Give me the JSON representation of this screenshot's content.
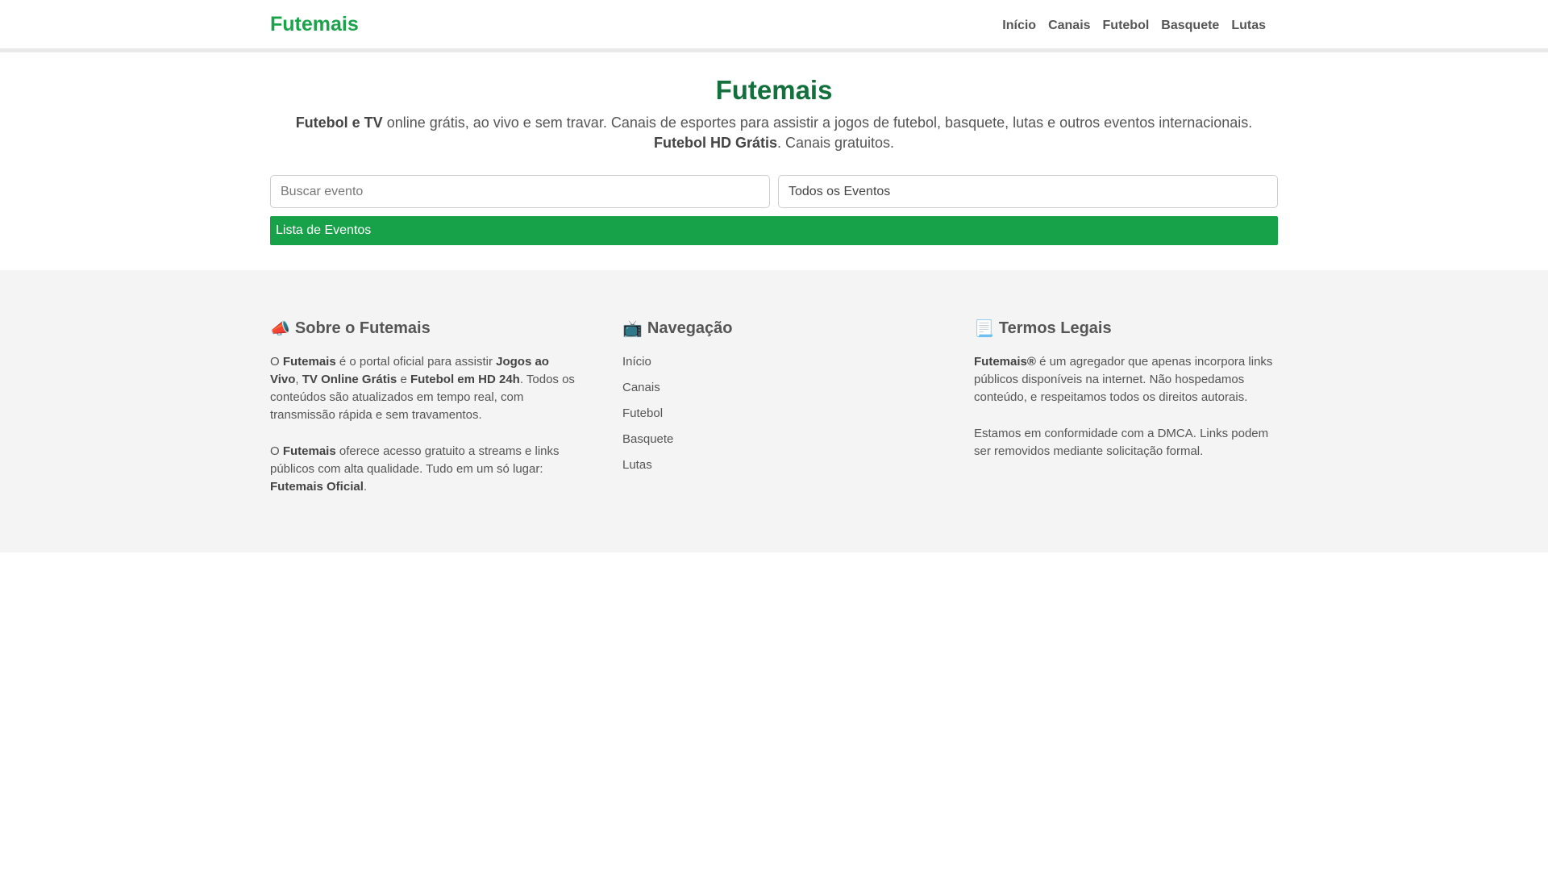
{
  "header": {
    "brand": "Futemais",
    "nav": [
      "Início",
      "Canais",
      "Futebol",
      "Basquete",
      "Lutas"
    ]
  },
  "hero": {
    "title": "Futemais",
    "line1_bold": "Futebol e TV",
    "line1_rest": " online grátis, ao vivo e sem travar. Canais de esportes para assistir a jogos de futebol, basquete, lutas e outros eventos internacionais.",
    "line2_bold": "Futebol HD Grátis",
    "line2_rest": ". Canais gratuitos."
  },
  "search": {
    "placeholder": "Buscar evento"
  },
  "filter": {
    "selected": "Todos os Eventos"
  },
  "list_header": "Lista de Eventos",
  "footer": {
    "about": {
      "icon": "📣",
      "title": "Sobre o Futemais",
      "p1": {
        "a": "O ",
        "b": "Futemais",
        "c": " é o portal oficial para assistir ",
        "d": "Jogos ao Vivo",
        "e": ", ",
        "f": "TV Online Grátis",
        "g": " e ",
        "h": "Futebol em HD 24h",
        "i": ". Todos os conteúdos são atualizados em tempo real, com transmissão rápida e sem travamentos."
      },
      "p2": {
        "a": "O ",
        "b": "Futemais",
        "c": " oferece acesso gratuito a streams e links públicos com alta qualidade. Tudo em um só lugar: ",
        "d": "Futemais Oficial",
        "e": "."
      }
    },
    "navigation": {
      "icon": "📺",
      "title": "Navegação",
      "links": [
        "Início",
        "Canais",
        "Futebol",
        "Basquete",
        "Lutas"
      ]
    },
    "legal": {
      "icon": "📃",
      "title": "Termos Legais",
      "p1_bold": "Futemais®",
      "p1_rest": " é um agregador que apenas incorpora links públicos disponíveis na internet. Não hospedamos conteúdo, e respeitamos todos os direitos autorais.",
      "p2": "Estamos em conformidade com a DMCA. Links podem ser removidos mediante solicitação formal."
    }
  },
  "colors": {
    "brand": "#1aa34a",
    "title": "#13703c",
    "bar": "#17a24a"
  }
}
